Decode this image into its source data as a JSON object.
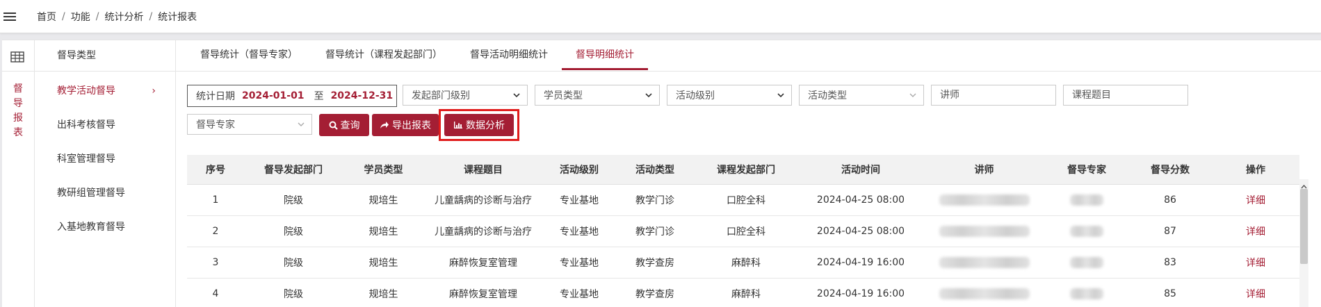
{
  "topbar": {
    "breadcrumb": [
      "首页",
      "功能",
      "统计分析",
      "统计报表"
    ],
    "separator": "/"
  },
  "rail": {
    "label": "督导报表",
    "icon": "table-grid-icon"
  },
  "sidebar": {
    "header": "督导类型",
    "items": [
      {
        "label": "教学活动督导",
        "active": true,
        "chevron": "›"
      },
      {
        "label": "出科考核督导"
      },
      {
        "label": "科室管理督导"
      },
      {
        "label": "教研组管理督导"
      },
      {
        "label": "入基地教育督导"
      }
    ]
  },
  "tabs": [
    {
      "label": "督导统计（督导专家）"
    },
    {
      "label": "督导统计（课程发起部门）"
    },
    {
      "label": "督导活动明细统计"
    },
    {
      "label": "督导明细统计",
      "active": true
    }
  ],
  "filters": {
    "date_label": "统计日期",
    "date_start": "2024-01-01",
    "date_to": "至",
    "date_end": "2024-12-31",
    "dept_level": "发起部门级别",
    "student_type": "学员类型",
    "activity_level": "活动级别",
    "activity_type": "活动类型",
    "lecturer_placeholder": "讲师",
    "course_placeholder": "课程题目",
    "expert": "督导专家"
  },
  "buttons": {
    "query": "查询",
    "export": "导出报表",
    "analysis": "数据分析"
  },
  "table": {
    "headers": [
      "序号",
      "督导发起部门",
      "学员类型",
      "课程题目",
      "活动级别",
      "活动类型",
      "课程发起部门",
      "活动时间",
      "讲师",
      "督导专家",
      "督导分数",
      "操作"
    ],
    "rows": [
      {
        "no": "1",
        "dept": "院级",
        "student": "规培生",
        "course": "儿童龋病的诊断与治疗",
        "level": "专业基地",
        "type": "教学门诊",
        "course_dept": "口腔全科",
        "time": "2024-04-25 08:00",
        "score": "86",
        "action": "详细"
      },
      {
        "no": "2",
        "dept": "院级",
        "student": "规培生",
        "course": "儿童龋病的诊断与治疗",
        "level": "专业基地",
        "type": "教学门诊",
        "course_dept": "口腔全科",
        "time": "2024-04-25 08:00",
        "score": "87",
        "action": "详细"
      },
      {
        "no": "3",
        "dept": "院级",
        "student": "规培生",
        "course": "麻醉恢复室管理",
        "level": "专业基地",
        "type": "教学查房",
        "course_dept": "麻醉科",
        "time": "2024-04-19 16:00",
        "score": "83",
        "action": "详细"
      },
      {
        "no": "4",
        "dept": "院级",
        "student": "规培生",
        "course": "麻醉恢复室管理",
        "level": "专业基地",
        "type": "教学查房",
        "course_dept": "麻醉科",
        "time": "2024-04-19 16:00",
        "score": "85",
        "action": "详细"
      }
    ]
  },
  "colors": {
    "accent": "#a41e34",
    "highlight": "#e01b1b"
  }
}
